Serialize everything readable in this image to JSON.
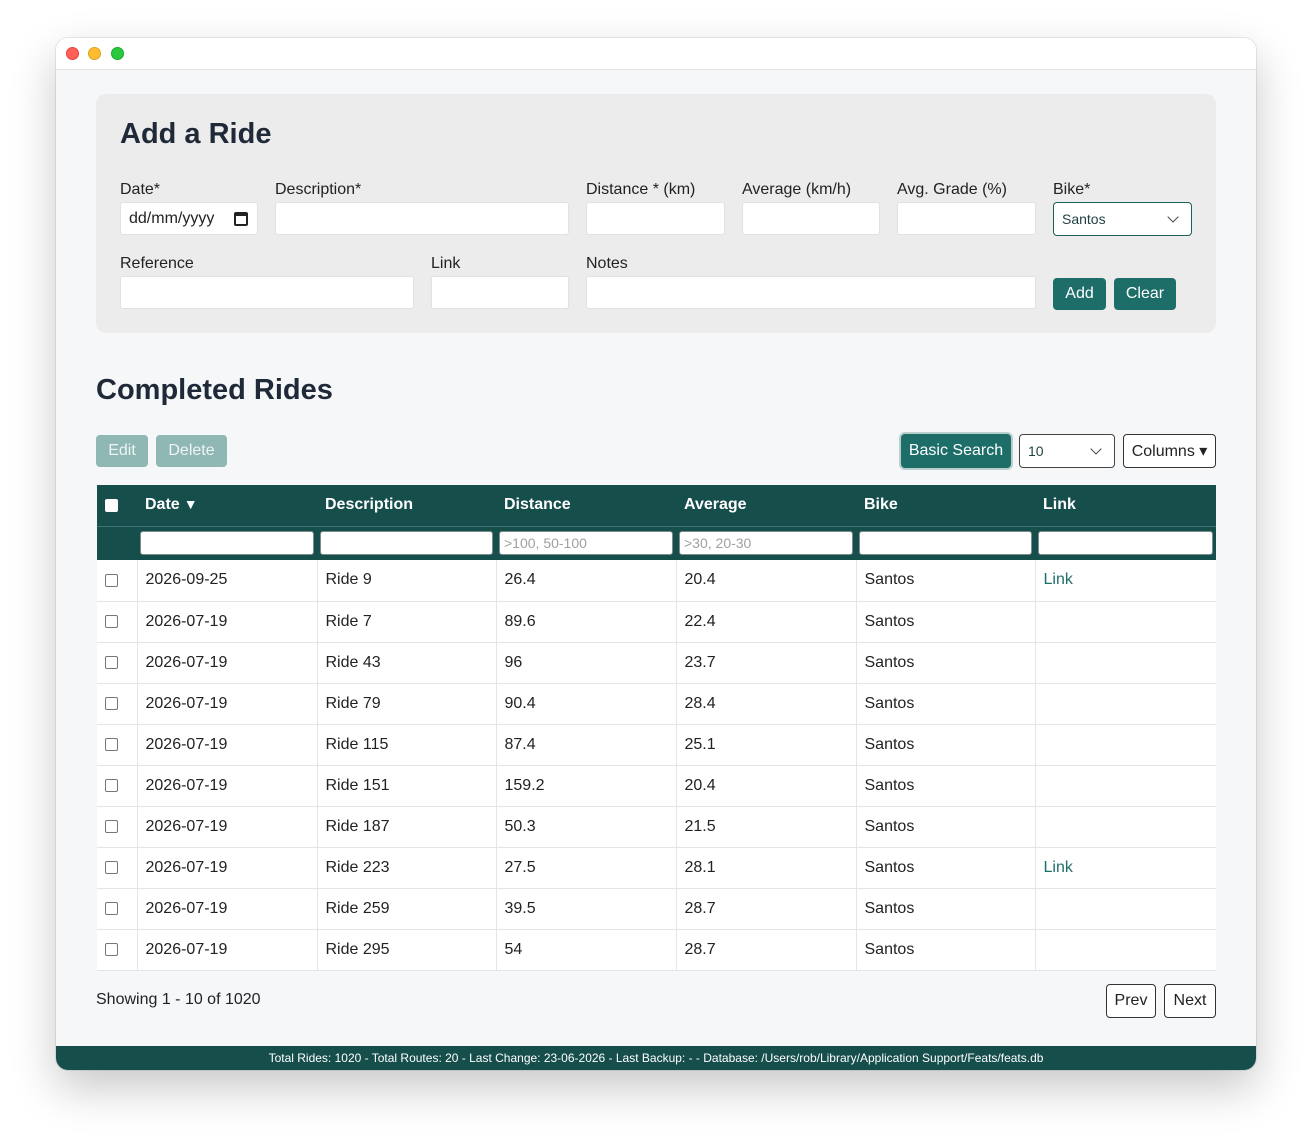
{
  "form": {
    "title": "Add a Ride",
    "labels": {
      "date": "Date*",
      "description": "Description*",
      "distance": "Distance * (km)",
      "average": "Average (km/h)",
      "grade": "Avg. Grade (%)",
      "bike": "Bike*",
      "reference": "Reference",
      "link": "Link",
      "notes": "Notes"
    },
    "date_placeholder": "dd/mm/yyyy",
    "bike_value": "Santos",
    "add_label": "Add",
    "clear_label": "Clear"
  },
  "rides": {
    "title": "Completed Rides",
    "edit_label": "Edit",
    "delete_label": "Delete",
    "basic_search_label": "Basic Search",
    "page_size": "10",
    "columns_label": "Columns ▾",
    "headers": {
      "date": "Date",
      "sort_arrow": "▼",
      "description": "Description",
      "distance": "Distance",
      "average": "Average",
      "bike": "Bike",
      "link": "Link"
    },
    "filter_placeholders": {
      "distance": ">100, 50-100",
      "average": ">30, 20-30"
    },
    "rows": [
      {
        "date": "2026-09-25",
        "description": "Ride 9",
        "distance": "26.4",
        "average": "20.4",
        "bike": "Santos",
        "link": "Link"
      },
      {
        "date": "2026-07-19",
        "description": "Ride 7",
        "distance": "89.6",
        "average": "22.4",
        "bike": "Santos",
        "link": ""
      },
      {
        "date": "2026-07-19",
        "description": "Ride 43",
        "distance": "96",
        "average": "23.7",
        "bike": "Santos",
        "link": ""
      },
      {
        "date": "2026-07-19",
        "description": "Ride 79",
        "distance": "90.4",
        "average": "28.4",
        "bike": "Santos",
        "link": ""
      },
      {
        "date": "2026-07-19",
        "description": "Ride 115",
        "distance": "87.4",
        "average": "25.1",
        "bike": "Santos",
        "link": ""
      },
      {
        "date": "2026-07-19",
        "description": "Ride 151",
        "distance": "159.2",
        "average": "20.4",
        "bike": "Santos",
        "link": ""
      },
      {
        "date": "2026-07-19",
        "description": "Ride 187",
        "distance": "50.3",
        "average": "21.5",
        "bike": "Santos",
        "link": ""
      },
      {
        "date": "2026-07-19",
        "description": "Ride 223",
        "distance": "27.5",
        "average": "28.1",
        "bike": "Santos",
        "link": "Link"
      },
      {
        "date": "2026-07-19",
        "description": "Ride 259",
        "distance": "39.5",
        "average": "28.7",
        "bike": "Santos",
        "link": ""
      },
      {
        "date": "2026-07-19",
        "description": "Ride 295",
        "distance": "54",
        "average": "28.7",
        "bike": "Santos",
        "link": ""
      }
    ],
    "showing": "Showing 1 - 10 of 1020",
    "prev_label": "Prev",
    "next_label": "Next"
  },
  "status": "Total Rides: 1020 - Total Routes: 20 - Last Change: 23-06-2026 - Last Backup: - - Database: /Users/rob/Library/Application Support/Feats/feats.db",
  "colors": {
    "accent": "#1d6e68",
    "table_header": "#164e4c",
    "panel": "#ececec"
  }
}
